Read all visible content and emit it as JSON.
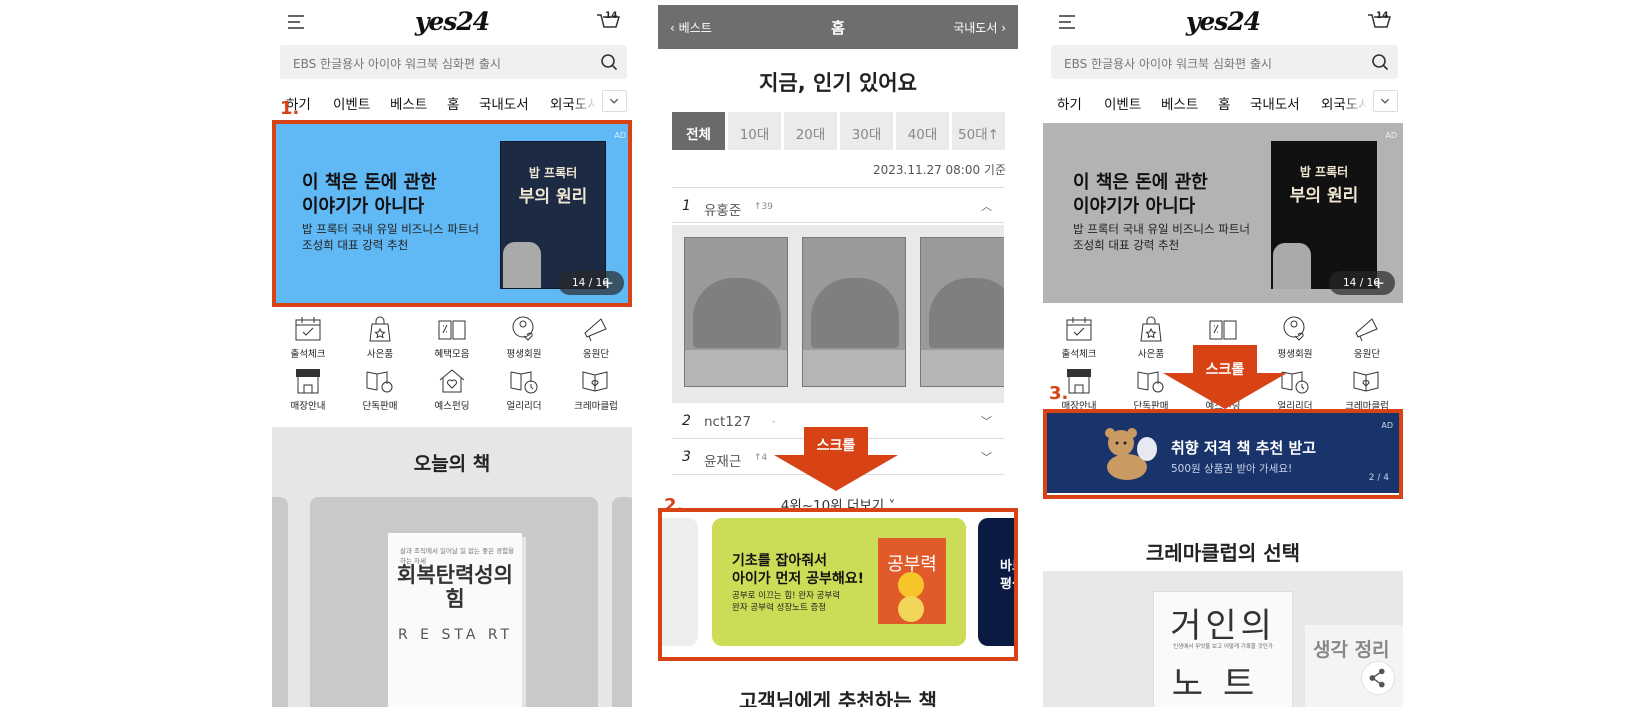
{
  "header": {
    "logo": "yes24",
    "cart_count": "14",
    "search_placeholder": "EBS 한글용사 아이야 워크북 심화편 출시"
  },
  "nav_tabs": {
    "p1": [
      "하기",
      "이벤트",
      "베스트",
      "홈",
      "국내도서",
      "외국도서"
    ],
    "p3": [
      "하기",
      "이벤트",
      "베스트",
      "홈",
      "국내도서",
      "외국도서"
    ]
  },
  "banner": {
    "headline": "이 책은 돈에 관한\n이야기가 아니다",
    "sub": "밥 프록터 국내 유일 비즈니스 파트너\n조성희 대표 강력 추천",
    "book_title_1": "밥 프록터",
    "book_title_2": "부의 원리",
    "ad": "AD",
    "pager": "14 / 16",
    "pager_plus": "+"
  },
  "quick_menu": [
    "출석체크",
    "사은품",
    "혜택모음",
    "평생회원",
    "응원단",
    "매장안내",
    "단독판매",
    "예스펀딩",
    "얼리리더",
    "크레마클럽"
  ],
  "today_books": {
    "title": "오늘의 책",
    "book_title": "회복탄력성의\n힘",
    "book_sub": "삶과 조직에서 일어날 일 없는 좋은 경험을 하는 자세",
    "letters": "R E STA RT"
  },
  "ranking": {
    "prev": "베스트",
    "title": "홈",
    "next": "국내도서",
    "heading": "지금, 인기 있어요",
    "ages": [
      "전체",
      "10대",
      "20대",
      "30대",
      "40대",
      "50대↑"
    ],
    "date": "2023.11.27 08:00 기준",
    "rows": [
      {
        "rank": "1",
        "name": "유홍준",
        "change": "↑39"
      },
      {
        "rank": "2",
        "name": "nct127",
        "change": "-"
      },
      {
        "rank": "3",
        "name": "윤재근",
        "change": "↑4"
      }
    ],
    "more": "4위~10위 더보기"
  },
  "ad2": {
    "headline": "기초를 잡아줘서\n아이가 먼저 공부해요!",
    "sub": "공부로 이끄는 힘! 완자 공부력\n완자 공부력 성장노트 증정",
    "book": "공부력",
    "next": "바로\n평생"
  },
  "below": {
    "recommend": "고객님에게 추천하는 책"
  },
  "pref_banner": {
    "headline": "취향 저격 책 추천 받고",
    "sub": "500원 상품권 받아 가세요!",
    "pager": "2 / 4",
    "ad": "AD"
  },
  "crema": {
    "title": "크레마클럽의 선택",
    "book_a": "거인의",
    "book_b": "노트",
    "book_sub": "인생에서 무엇을 보고 어떻게 기록할 것인가",
    "side_book": "생각 정리"
  },
  "annotations": {
    "step1": "1.",
    "step2": "2.",
    "step3": "3.",
    "scroll": "스크롤",
    "color": "#d84315"
  }
}
